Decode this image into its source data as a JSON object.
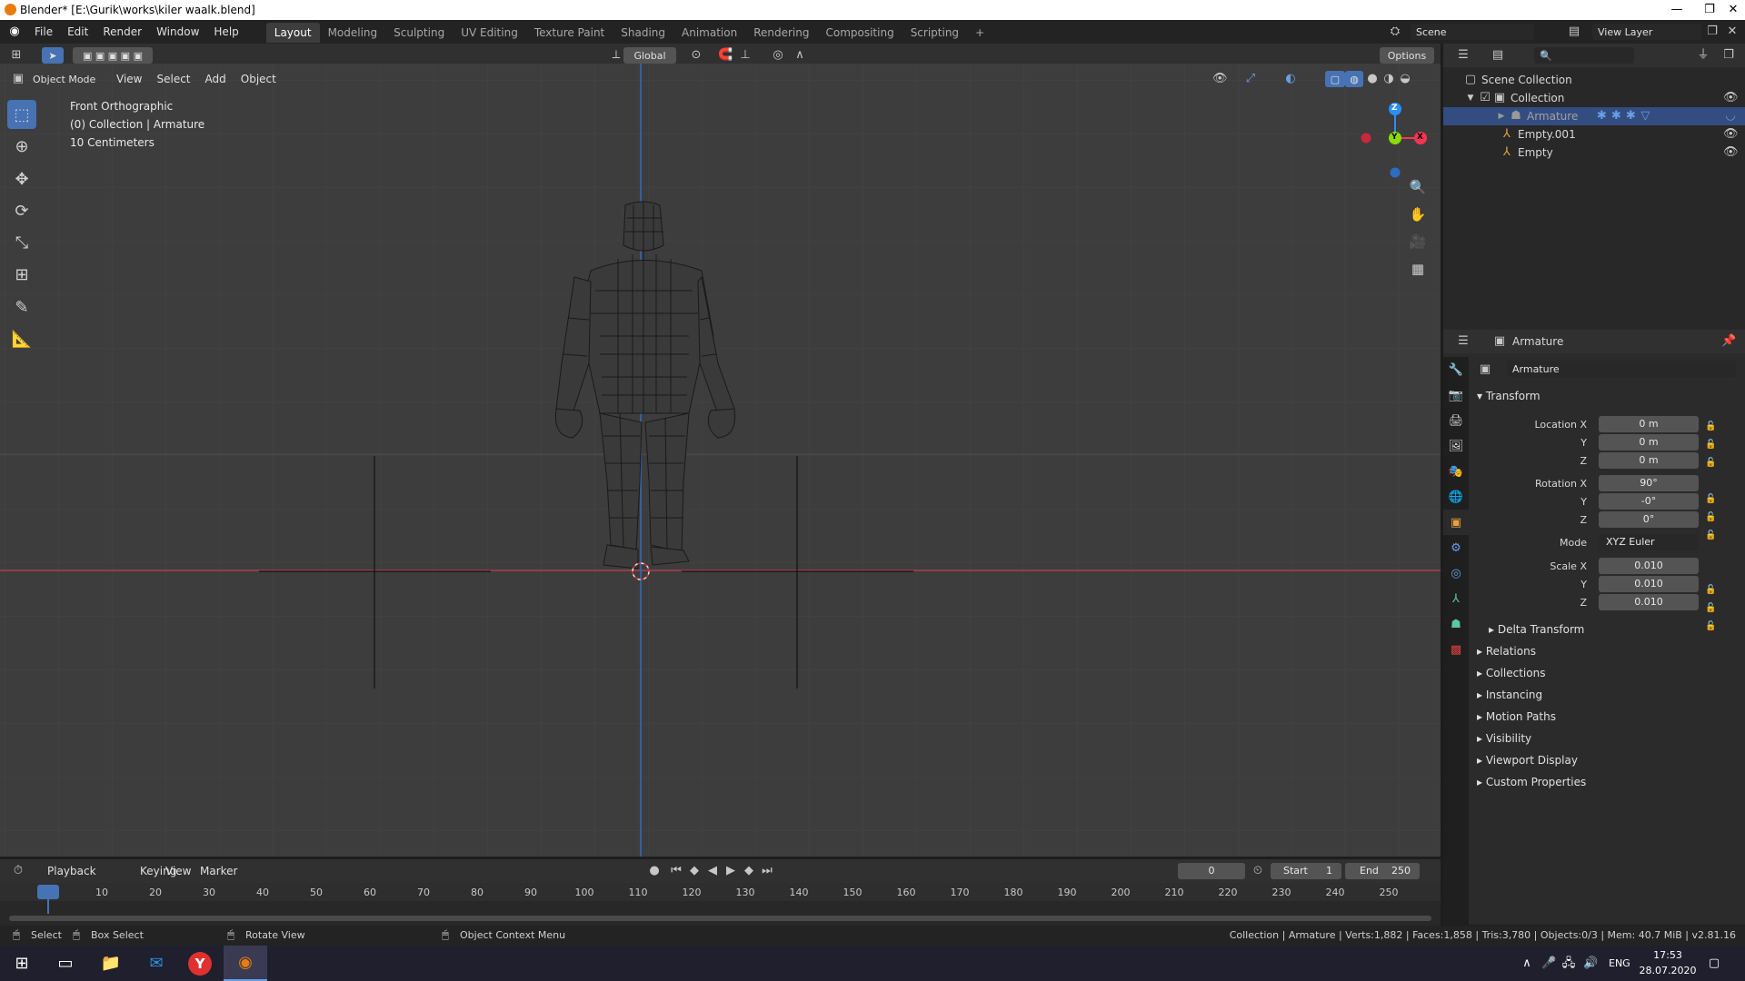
{
  "window": {
    "title": "Blender* [E:\\Gurik\\works\\kiler waalk.blend]",
    "minimize": "—",
    "maximize": "❐",
    "close": "✕"
  },
  "menu": [
    "File",
    "Edit",
    "Render",
    "Window",
    "Help"
  ],
  "workspaces": [
    "Layout",
    "Modeling",
    "Sculpting",
    "UV Editing",
    "Texture Paint",
    "Shading",
    "Animation",
    "Rendering",
    "Compositing",
    "Scripting",
    "+"
  ],
  "scene": {
    "name": "Scene",
    "view_layer": "View Layer"
  },
  "viewport": {
    "mode": "Object Mode",
    "menus": [
      "View",
      "Select",
      "Add",
      "Object"
    ],
    "orientation": "Global",
    "options": "Options",
    "info": [
      "Front Orthographic",
      "(0) Collection | Armature",
      "10 Centimeters"
    ],
    "gizmo": {
      "z": "Z",
      "y": "Y",
      "x": "X"
    }
  },
  "outliner": {
    "items": [
      {
        "label": "Scene Collection"
      },
      {
        "label": "Collection"
      },
      {
        "label": "Armature"
      },
      {
        "label": "Empty.001"
      },
      {
        "label": "Empty"
      }
    ]
  },
  "properties": {
    "object_name": "Armature",
    "data_name": "Armature",
    "transform_label": "Transform",
    "location": {
      "label": "Location X",
      "x": "0 m",
      "y": "0 m",
      "z": "0 m"
    },
    "rotation": {
      "label": "Rotation X",
      "x": "90°",
      "y": "-0°",
      "z": "0°"
    },
    "mode": {
      "label": "Mode",
      "value": "XYZ Euler"
    },
    "scale": {
      "label": "Scale X",
      "x": "0.010",
      "y": "0.010",
      "z": "0.010"
    },
    "axis_y": "Y",
    "axis_z": "Z",
    "subsection": "Delta Transform",
    "sections": [
      "Relations",
      "Collections",
      "Instancing",
      "Motion Paths",
      "Visibility",
      "Viewport Display",
      "Custom Properties"
    ]
  },
  "timeline": {
    "menus": [
      "Playback",
      "Keying",
      "View",
      "Marker"
    ],
    "current_frame": "0",
    "start_label": "Start",
    "start": "1",
    "end_label": "End",
    "end": "250",
    "ticks": [
      "0",
      "10",
      "20",
      "30",
      "40",
      "50",
      "60",
      "70",
      "80",
      "90",
      "100",
      "110",
      "120",
      "130",
      "140",
      "150",
      "160",
      "170",
      "180",
      "190",
      "200",
      "210",
      "220",
      "230",
      "240",
      "250"
    ]
  },
  "status": {
    "select": "Select",
    "box_select": "Box Select",
    "rotate_view": "Rotate View",
    "context_menu": "Object Context Menu",
    "stats": "Collection | Armature | Verts:1,882 | Faces:1,858 | Tris:3,780 | Objects:0/3 | Mem: 40.7 MiB | v2.81.16"
  },
  "taskbar": {
    "lang": "ENG",
    "time": "17:53",
    "date": "28.07.2020"
  },
  "colors": {
    "accent": "#4772b3",
    "selected_row": "#334d80",
    "x_axis": "#ff3352",
    "y_axis": "#8bdc00",
    "z_axis": "#2890ff",
    "orange": "#e87d0d"
  }
}
